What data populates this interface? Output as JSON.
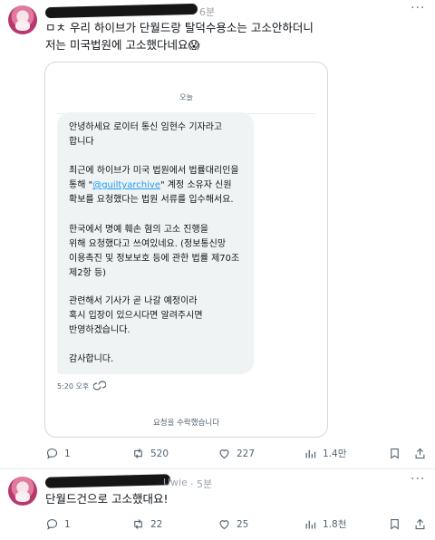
{
  "tweet1": {
    "time_fragment": "6분",
    "text_line1": "ㅁㅊ 우리 하이브가 단월드랑 탈덕수용소는 고소안하더니",
    "text_line2": "저는 미국법원에 고소했다네요😱",
    "actions": {
      "replies": "1",
      "retweets": "520",
      "likes": "227",
      "views": "1.4만"
    }
  },
  "dm": {
    "date": "오늘",
    "lines": [
      "안녕하세요 로이터 통신 임현수 기자라고",
      "합니다",
      "최근에 하이브가 미국 법원에서 법률대리인을",
      "통해 \"",
      "\" 계정 소유자 신원",
      "확보를 요청했다는 법원 서류를 입수해서요.",
      "한국에서 명예 훼손 혐의 고소 진행을",
      "위해 요청했다고 쓰여있네요. (정보통신망",
      "이용촉진 및 정보보호 등에 관한 법률 제70조",
      "제2항 등)",
      "관련해서 기사가 곧 나갈 예정이라",
      "혹시 입장이 있으시다면 알려주시면",
      "반영하겠습니다.",
      "감사합니다."
    ],
    "link": "@guiltyarchive",
    "time": "5:20 오후",
    "accept": "요청을 수락했습니다"
  },
  "tweet2": {
    "handle_fragment": "Uwie",
    "time_fragment": "· 5분",
    "text": "단월드건으로 고소했대요!",
    "actions": {
      "replies": "1",
      "retweets": "22",
      "likes": "25",
      "views": "1.8천"
    }
  },
  "icons": {
    "reply": "reply-icon",
    "retweet": "retweet-icon",
    "like": "heart-icon",
    "views": "views-icon",
    "bookmark": "bookmark-icon",
    "share": "share-icon",
    "more": "more-icon",
    "seen": "seen-icon"
  },
  "colors": {
    "link": "#1d9bf0",
    "muted": "#536471",
    "bubble": "#eff3f4",
    "border": "#cfd9de"
  }
}
